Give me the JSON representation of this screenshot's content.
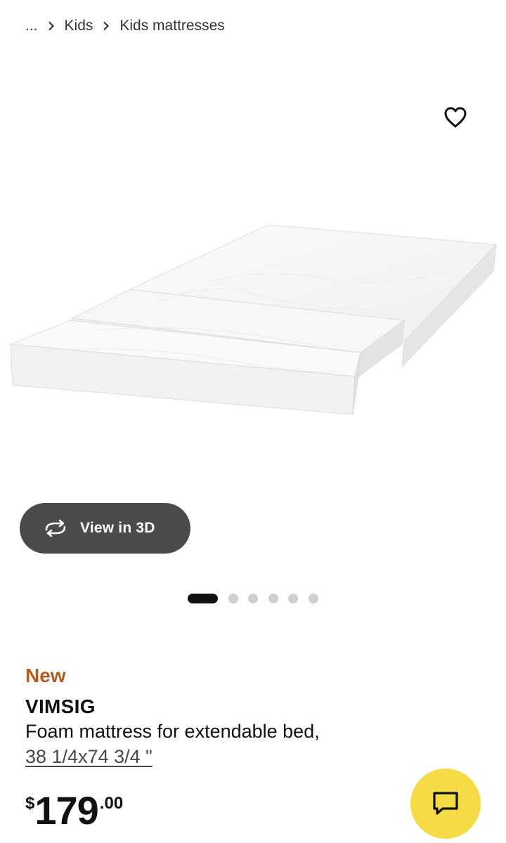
{
  "breadcrumb": {
    "ellipsis": "...",
    "items": [
      "Kids",
      "Kids mattresses"
    ]
  },
  "gallery": {
    "view_3d_label": "View in 3D",
    "total_images": 6,
    "active_index": 0
  },
  "product": {
    "badge": "New",
    "name": "VIMSIG",
    "description": "Foam mattress for extendable bed,",
    "size": "38 1/4x74 3/4 \"",
    "price": {
      "currency": "$",
      "integer": "179",
      "decimal": ".00"
    }
  },
  "icons": {
    "favorite": "heart-outline-icon",
    "view_3d": "rotate-3d-icon",
    "chat": "chat-bubble-icon",
    "breadcrumb_separator": "chevron-right-icon"
  },
  "colors": {
    "new_badge": "#b35c1e",
    "view_3d_button": "#4b4b4b",
    "chat_button": "#f5dc47",
    "active_dot": "#111111",
    "inactive_dot": "#cfcfcf"
  }
}
